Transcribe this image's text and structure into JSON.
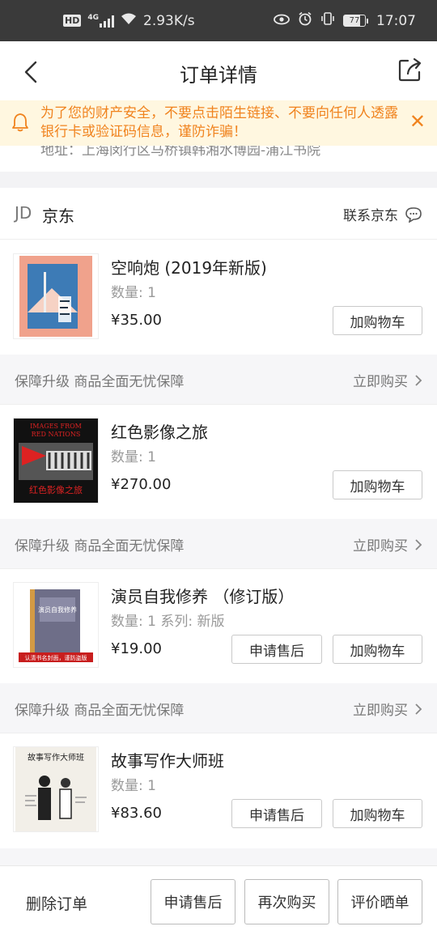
{
  "status_bar": {
    "hd": "HD",
    "network": "4G",
    "speed": "2.93K/s",
    "battery": "77",
    "time": "17:07"
  },
  "nav": {
    "title": "订单详情"
  },
  "notice": {
    "text": "为了您的财产安全，不要点击陌生链接、不要向任何人透露银行卡或验证码信息，谨防诈骗！"
  },
  "address": {
    "text": "地址：上海闵行区马桥镇韩湘水博园-浦江书院"
  },
  "shop": {
    "logo": "JD",
    "name": "京东",
    "contact": "联系京东"
  },
  "items": [
    {
      "title": "空响炮 (2019年新版)",
      "qty": "数量: 1",
      "price": "¥35.00",
      "cart": "加购物车"
    },
    {
      "title": "红色影像之旅",
      "qty": "数量: 1",
      "price": "¥270.00",
      "cart": "加购物车",
      "cover_text_top": "IMAGES FROM RED NATIONS",
      "cover_text_bottom": "红色影像之旅"
    },
    {
      "title": "演员自我修养 （修订版）",
      "qty": "数量: 1 系列: 新版",
      "price": "¥19.00",
      "after_sale": "申请售后",
      "cart": "加购物车",
      "cover_text": "演员自我修养",
      "cover_banner": "认清书名封面，谨防盗版"
    },
    {
      "title": "故事写作大师班",
      "qty": "数量: 1",
      "price": "¥83.60",
      "after_sale": "申请售后",
      "cart": "加购物车",
      "cover_text": "故事写作大师班"
    }
  ],
  "guard": {
    "left": "保障升级 商品全面无忧保障",
    "right": "立即购买"
  },
  "footer": {
    "delete": "删除订单",
    "after_sale": "申请售后",
    "rebuy": "再次购买",
    "review": "评价晒单"
  },
  "colors": {
    "notice_bg": "#fff7e0",
    "notice_text": "#f0831e",
    "status_bar": "#3a3a3a"
  }
}
